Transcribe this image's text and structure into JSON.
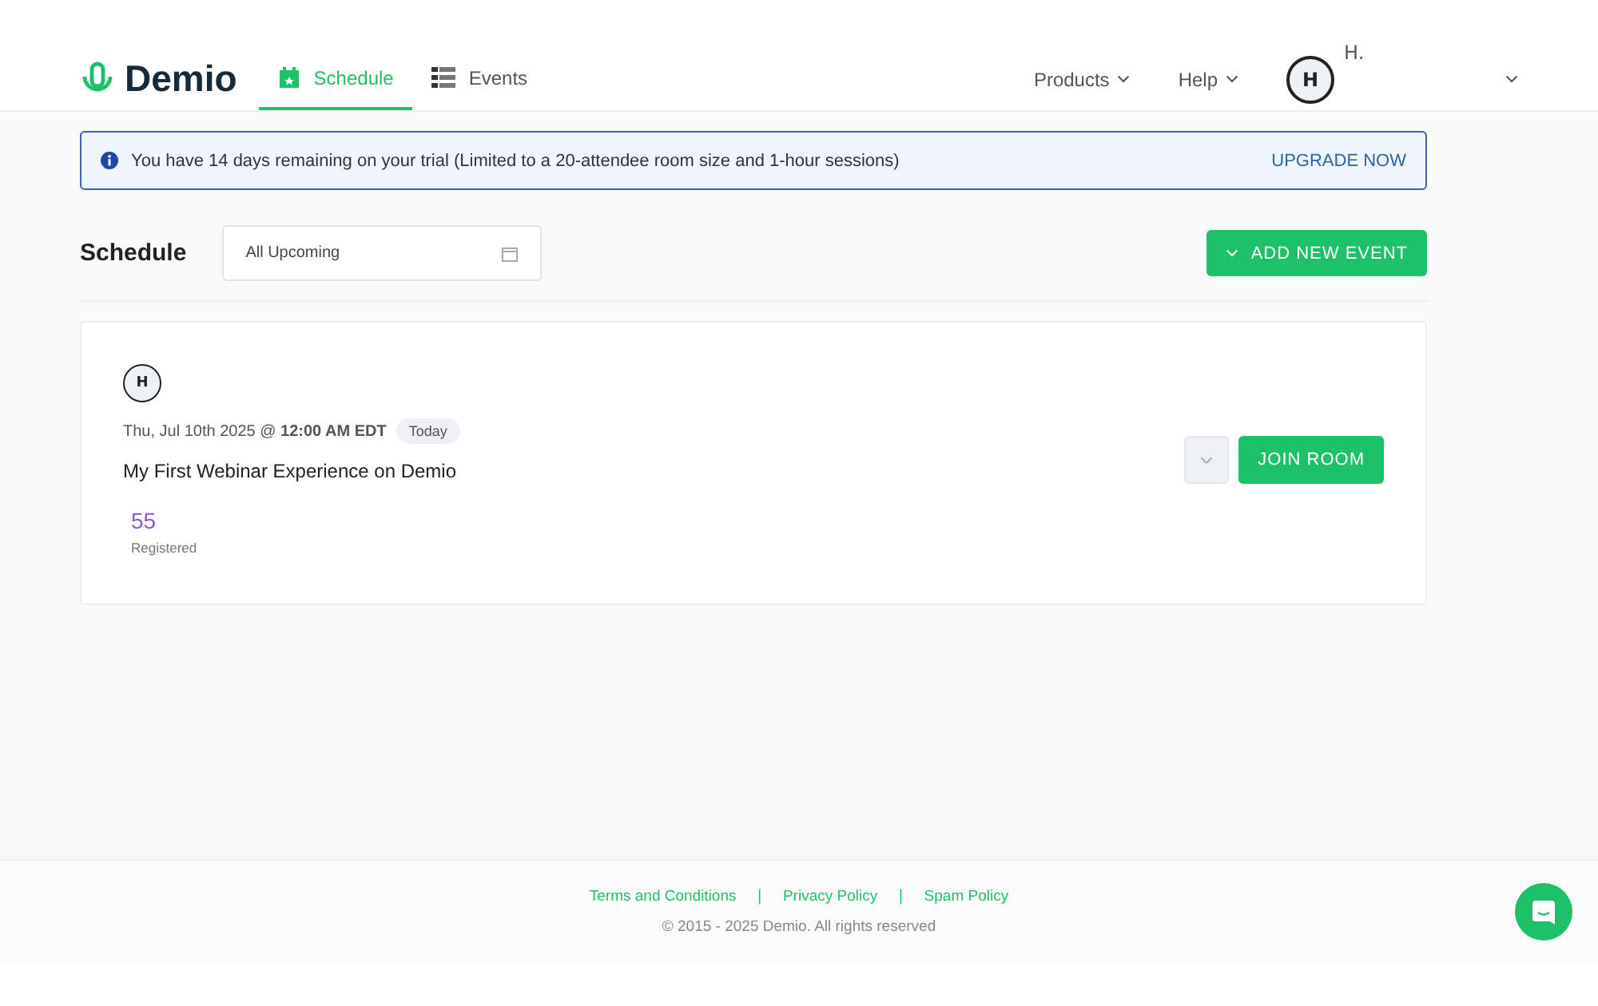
{
  "header": {
    "logo": "Demio",
    "tabs": [
      {
        "label": "Schedule",
        "selected": true
      },
      {
        "label": "Events",
        "selected": false
      }
    ],
    "menus": [
      {
        "label": "Products"
      },
      {
        "label": "Help"
      }
    ],
    "user": {
      "initial": "H",
      "name": "H."
    }
  },
  "banner": {
    "text": "You have 14 days remaining on your trial (Limited to a 20-attendee room size and 1-hour sessions)",
    "action": "UPGRADE NOW"
  },
  "toolbar": {
    "title": "Schedule",
    "filter": "All Upcoming",
    "button": "ADD NEW EVENT"
  },
  "events": [
    {
      "host_initial": "H",
      "datetime": "Thu, Jul 10th 2025 @ **12:00 AM EDT**",
      "badge": "Today",
      "title": "My First Webinar Experience on Demio",
      "count": "55",
      "count_label": "Registered",
      "action": "JOIN ROOM"
    }
  ],
  "footer": {
    "items": [
      {
        "kind": "link",
        "text": "Terms and Conditions"
      },
      {
        "kind": "separator",
        "text": "|"
      },
      {
        "kind": "link",
        "text": "Privacy Policy"
      },
      {
        "kind": "separator",
        "text": "|"
      },
      {
        "kind": "link",
        "text": "Spam Policy"
      }
    ],
    "copyright": "© 2015 - 2025 Demio. All rights reserved"
  }
}
